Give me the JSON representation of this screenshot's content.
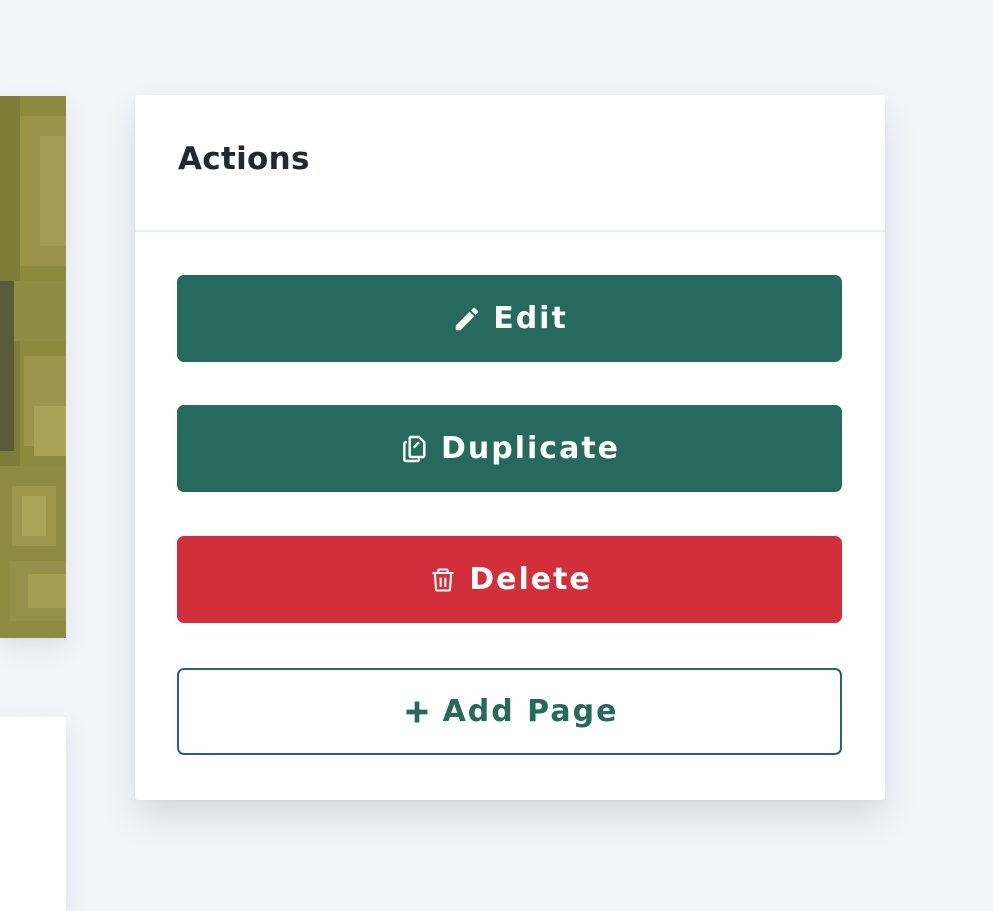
{
  "actions": {
    "title": "Actions",
    "buttons": {
      "edit": {
        "label": "Edit",
        "icon": "pencil-icon"
      },
      "duplicate": {
        "label": "Duplicate",
        "icon": "copy-icon"
      },
      "delete": {
        "label": "Delete",
        "icon": "trash-icon"
      },
      "add_page": {
        "label": "Add Page",
        "icon": "plus-icon"
      }
    }
  },
  "colors": {
    "background": "#f3f5f9",
    "primary": "#256a5c",
    "danger": "#d22f3b",
    "card": "#ffffff",
    "title_text": "#23282f"
  }
}
